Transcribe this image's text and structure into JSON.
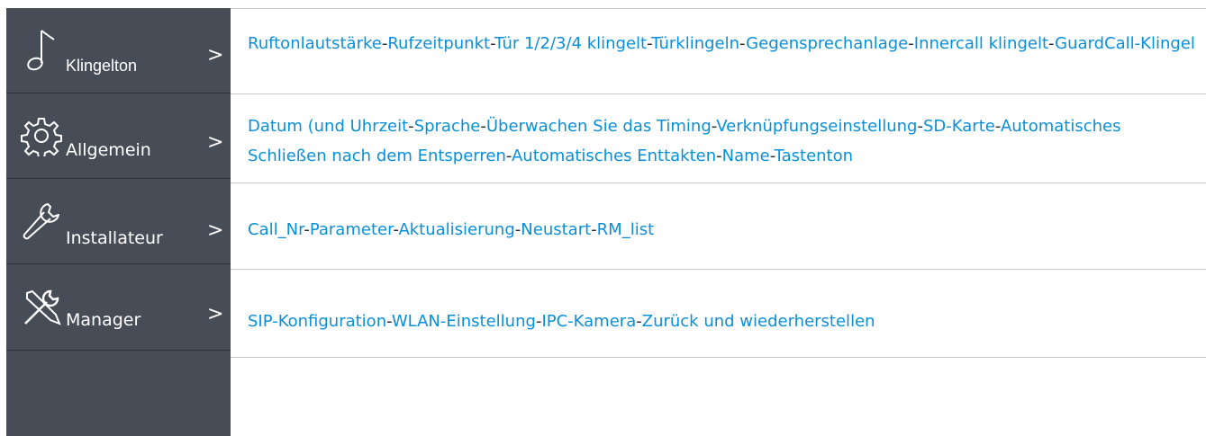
{
  "sidebar": {
    "items": [
      {
        "label": "Klingelton",
        "icon": "music-note-icon"
      },
      {
        "label": "Allgemein",
        "icon": "gear-icon"
      },
      {
        "label": "Installateur",
        "icon": "wrench-icon"
      },
      {
        "label": "Manager",
        "icon": "tools-icon"
      }
    ],
    "chevron": ">"
  },
  "sections": [
    {
      "links": [
        "Ruftonlautstärke",
        "Rufzeitpunkt",
        "Tür 1/2/3/4 klingelt",
        "Türklingeln",
        "Gegensprechanlage",
        "Innercall klingelt",
        "GuardCall-Klingel"
      ]
    },
    {
      "links": [
        "Datum (und Uhrzeit",
        "Sprache",
        "Überwachen Sie das Timing",
        "Verknüpfungseinstellung",
        "SD-Karte",
        "Automatisches Schließen nach dem Entsperren",
        "Automatisches Enttakten",
        "Name",
        "Tastenton"
      ]
    },
    {
      "links": [
        "Call_Nr",
        "Parameter",
        "Aktualisierung",
        "Neustart",
        "RM_list"
      ]
    },
    {
      "links": [
        "SIP-Konfiguration",
        "WLAN-Einstellung",
        "IPC-Kamera",
        "Zurück und wiederherstellen"
      ]
    }
  ],
  "separator": "-",
  "colors": {
    "sidebar": "#474d57",
    "link": "#0a8fd9",
    "separator": "#2a2a2a",
    "divider": "#c8c8c8"
  }
}
